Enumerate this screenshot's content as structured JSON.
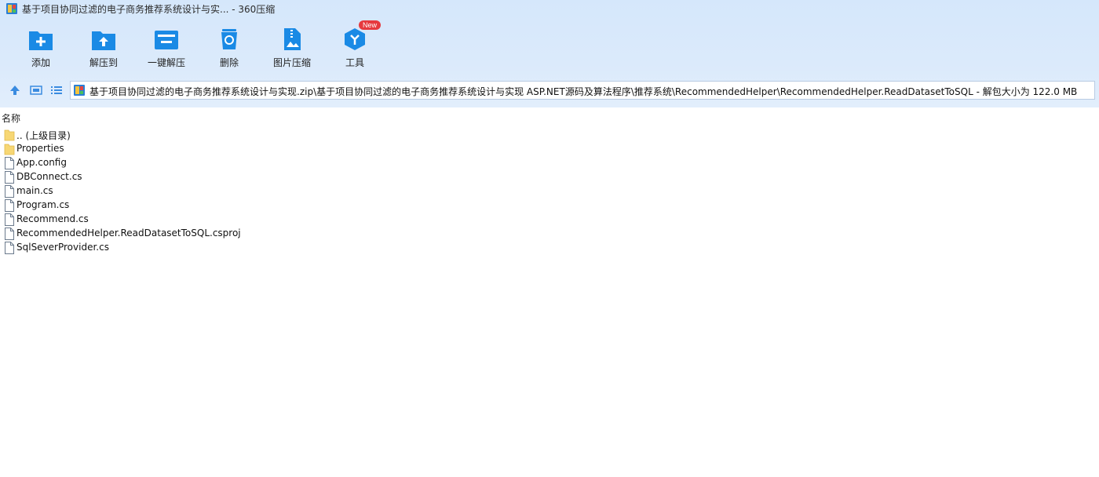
{
  "window": {
    "title": "基于项目协同过滤的电子商务推荐系统设计与实... - 360压缩"
  },
  "toolbar": {
    "add": "添加",
    "extract_to": "解压到",
    "one_click_extract": "一键解压",
    "delete": "删除",
    "image_compress": "图片压缩",
    "tools": "工具",
    "tools_badge": "New"
  },
  "address": {
    "path": "基于项目协同过滤的电子商务推荐系统设计与实现.zip\\基于项目协同过滤的电子商务推荐系统设计与实现 ASP.NET源码及算法程序\\推荐系统\\RecommendedHelper\\RecommendedHelper.ReadDatasetToSQL - 解包大小为 122.0 MB"
  },
  "columns": {
    "name": "名称"
  },
  "files": [
    {
      "name": ".. (上级目录)",
      "type": "folder"
    },
    {
      "name": "Properties",
      "type": "folder"
    },
    {
      "name": "App.config",
      "type": "file"
    },
    {
      "name": "DBConnect.cs",
      "type": "file"
    },
    {
      "name": "main.cs",
      "type": "file"
    },
    {
      "name": "Program.cs",
      "type": "file"
    },
    {
      "name": "Recommend.cs",
      "type": "file"
    },
    {
      "name": "RecommendedHelper.ReadDatasetToSQL.csproj",
      "type": "file"
    },
    {
      "name": "SqlSeverProvider.cs",
      "type": "file"
    }
  ],
  "colors": {
    "accent": "#1a8ae5",
    "header_bg": "#d8e9fb",
    "badge": "#e6393e"
  }
}
